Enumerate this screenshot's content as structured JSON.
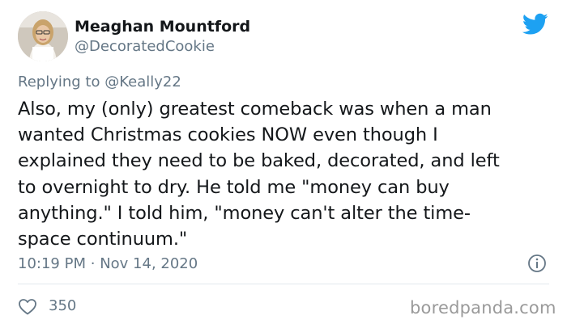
{
  "author": {
    "name": "Meaghan Mountford",
    "handle": "@DecoratedCookie"
  },
  "reply": {
    "prefix": "Replying to",
    "mention": "@Keally22"
  },
  "body_lines": [
    "Also, my (only) greatest comeback was when a man",
    "wanted Christmas cookies NOW even though I",
    "explained they need to be baked, decorated, and left",
    "to overnight to dry. He told me \"money can buy",
    "anything.\" I told him, \"money can't alter the time-",
    "space continuum.\""
  ],
  "meta": {
    "time": "10:19 PM",
    "separator": "·",
    "date": "Nov 14, 2020"
  },
  "likes": "350",
  "watermark": "boredpanda.com",
  "colors": {
    "brand": "#1da1f2",
    "secondary_text": "#657786",
    "primary_text": "#14171a"
  },
  "icons": {
    "logo": "twitter-bird-icon",
    "info": "info-icon",
    "like": "heart-icon"
  }
}
